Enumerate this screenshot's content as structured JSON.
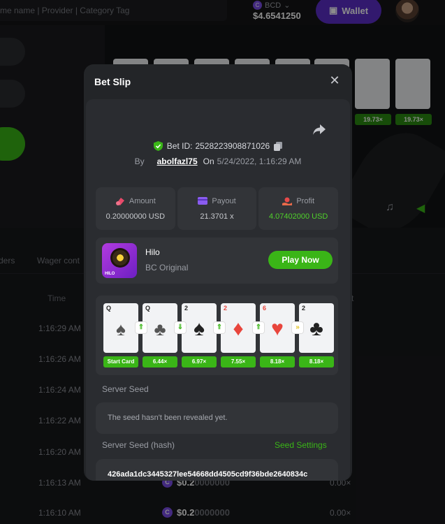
{
  "header": {
    "search_placeholder": "me name | Provider | Category Tag",
    "currency": "BCD",
    "balance": "$4.6541250",
    "wallet_label": "Wallet"
  },
  "background": {
    "tabs": [
      "ders",
      "Wager cont"
    ],
    "col_time": "Time",
    "col_extra": "t",
    "multipliers": [
      "19.73×",
      "19.73×"
    ],
    "rows": [
      {
        "time": "1:16:29 AM"
      },
      {
        "time": "1:16:26 AM"
      },
      {
        "time": "1:16:24 AM"
      },
      {
        "time": "1:16:22 AM"
      },
      {
        "time": "1:16:20 AM"
      },
      {
        "time": "1:16:13 AM",
        "amount_main": "$0.2",
        "amount_dim": "0000000",
        "payout": "0.00×"
      },
      {
        "time": "1:16:10 AM",
        "amount_main": "$0.2",
        "amount_dim": "0000000",
        "payout": "0.00×"
      }
    ]
  },
  "modal": {
    "title": "Bet Slip",
    "bet_id_label": "Bet ID:",
    "bet_id": "2528223908871026",
    "by_label": "By",
    "user": "abolfazl75",
    "on_label": "On",
    "datetime": "5/24/2022, 1:16:29 AM",
    "stats": [
      {
        "label": "Amount",
        "value": "0.20000000 USD"
      },
      {
        "label": "Payout",
        "value": "21.3701 x"
      },
      {
        "label": "Profit",
        "value": "4.07402000 USD"
      }
    ],
    "game": {
      "name": "Hilo",
      "subtitle": "BC Original",
      "thumb_label": "HILO",
      "play_label": "Play Now"
    },
    "cards": [
      {
        "rank": "Q",
        "suit": "♠",
        "red": false,
        "pill": "Start Card",
        "badge": ""
      },
      {
        "rank": "Q",
        "suit": "♣",
        "red": false,
        "pill": "6.44×",
        "badge": "⇑"
      },
      {
        "rank": "2",
        "suit": "♠",
        "red": false,
        "pill": "6.97×",
        "badge": "⇓"
      },
      {
        "rank": "2",
        "suit": "♦",
        "red": true,
        "pill": "7.55×",
        "badge": "⇑"
      },
      {
        "rank": "6",
        "suit": "♥",
        "red": true,
        "pill": "8.18×",
        "badge": "⇑"
      },
      {
        "rank": "2",
        "suit": "♣",
        "red": false,
        "pill": "8.18×",
        "badge": "»"
      }
    ],
    "server_seed_label": "Server Seed",
    "server_seed_value": "The seed hasn't been revealed yet.",
    "server_seed_hash_label": "Server Seed (hash)",
    "seed_settings_label": "Seed Settings",
    "server_seed_hash": "426ada1dc3445327lee54668dd4505cd9f36bde2640834c"
  }
}
